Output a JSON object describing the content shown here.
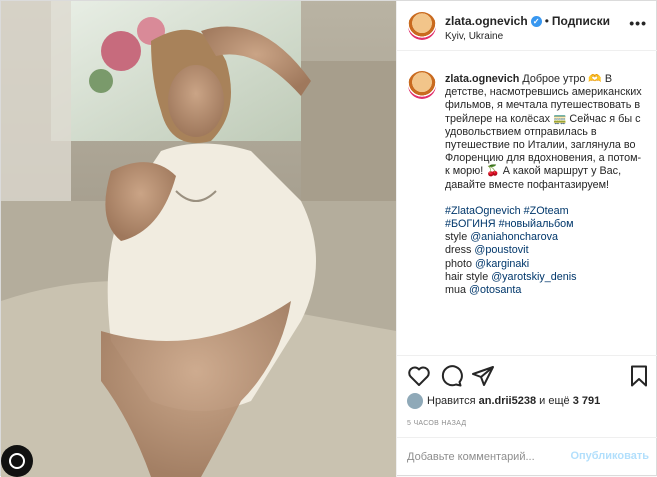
{
  "header": {
    "username": "zlata.ognevich",
    "verified_mark": "✓",
    "separator": "•",
    "follow_label": "Подписки",
    "location": "Kyiv, Ukraine",
    "more_label": "•••"
  },
  "caption": {
    "username": "zlata.ognevich",
    "text": "Доброе утро 🫶 В детстве, насмотревшись американских фильмов, я мечтала путешествовать в трейлере на колёсах 🚃 Сейчас я бы с удовольствием отправилась в путешествие по Италии, заглянула во Флоренцию для вдохновения, а потом- к морю! 🍒 А какой маршрут у Вас, давайте вместе пофантазируем!",
    "tags": [
      "#ZlataOgnevich #ZOteam",
      "#БОГИНЯ #новыйальбом"
    ],
    "credits": [
      {
        "label": "style ",
        "handle": "@aniahoncharova"
      },
      {
        "label": "dress ",
        "handle": "@poustovit"
      },
      {
        "label": "photo ",
        "handle": "@karginaki"
      },
      {
        "label": "hair style ",
        "handle": "@yarotskiy_denis"
      },
      {
        "label": "mua ",
        "handle": "@otosanta"
      }
    ]
  },
  "icons": {
    "like": "heart-icon",
    "comment": "comment-icon",
    "share": "share-icon",
    "save": "bookmark-icon"
  },
  "likes": {
    "prefix": "Нравится ",
    "user": "an.drii5238",
    "suffix": " и ещё ",
    "count": "3 791"
  },
  "time": "5 ЧАСОВ НАЗАД",
  "comment": {
    "placeholder": "Добавьте комментарий...",
    "publish_label": "Опубликовать"
  },
  "colors": {
    "link": "#00376b",
    "verified": "#3897f0",
    "publish_disabled": "#b2dffc"
  }
}
